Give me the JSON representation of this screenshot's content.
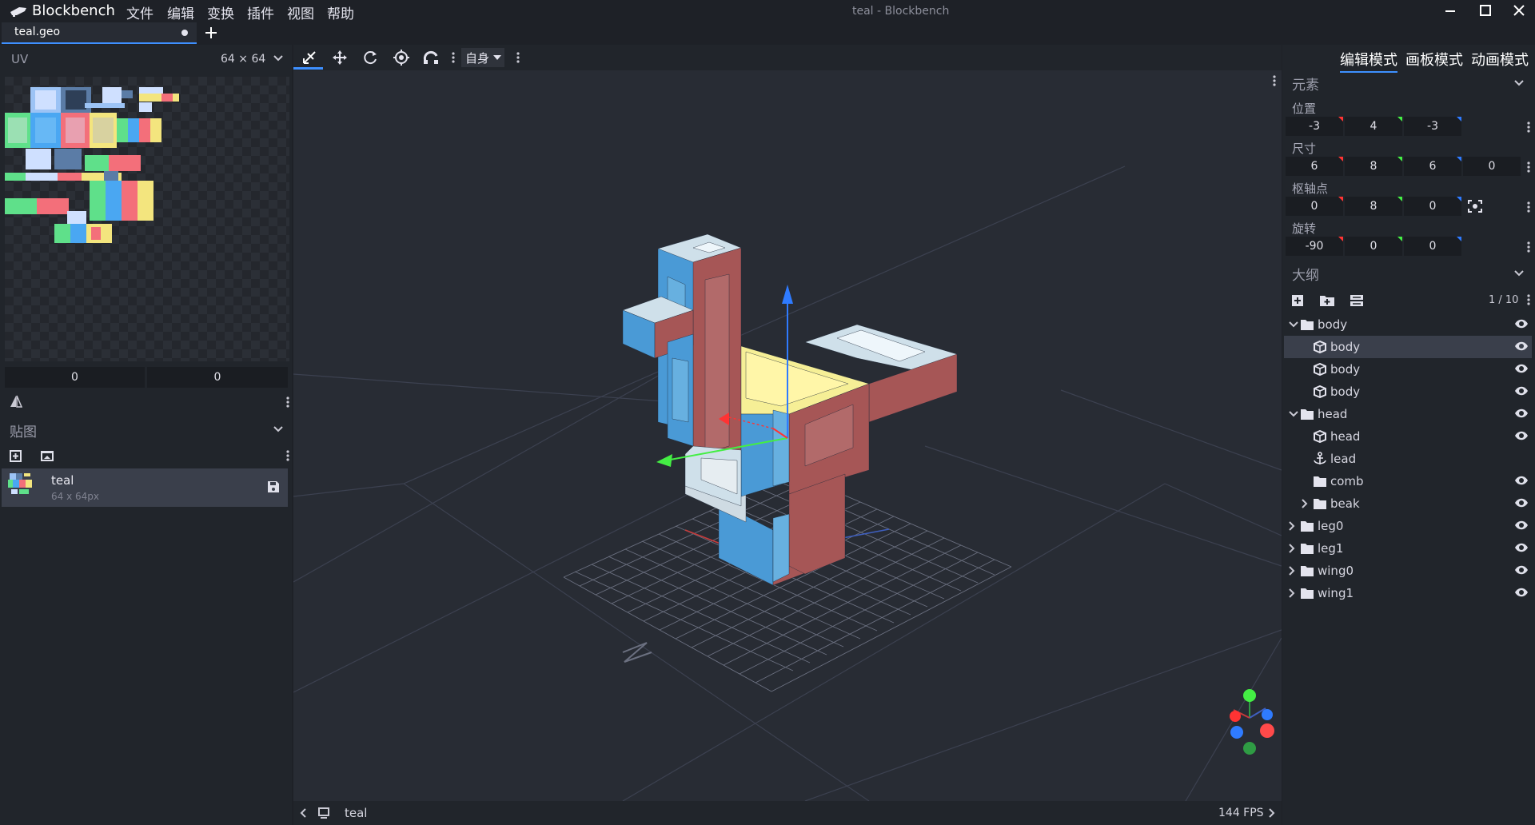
{
  "app": {
    "name": "Blockbench",
    "window_title": "teal - Blockbench",
    "menu": [
      "文件",
      "编辑",
      "变换",
      "插件",
      "视图",
      "帮助"
    ]
  },
  "tabs": [
    {
      "label": "teal.geo"
    }
  ],
  "uv_panel": {
    "title": "UV",
    "size_label": "64 × 64",
    "offset_x": "0",
    "offset_y": "0"
  },
  "textures_panel": {
    "title": "贴图",
    "items": [
      {
        "name": "teal",
        "size": "64 x 64px"
      }
    ]
  },
  "toolbar": {
    "space_select": "自身"
  },
  "modes": [
    "编辑模式",
    "画板模式",
    "动画模式"
  ],
  "element_panel": {
    "title": "元素",
    "position_label": "位置",
    "position": [
      "-3",
      "4",
      "-3"
    ],
    "size_label": "尺寸",
    "size": [
      "6",
      "8",
      "6",
      "0"
    ],
    "pivot_label": "枢轴点",
    "pivot": [
      "0",
      "8",
      "0"
    ],
    "rotation_label": "旋转",
    "rotation": [
      "-90",
      "0",
      "0"
    ]
  },
  "outliner": {
    "title": "大纲",
    "count": "1 / 10",
    "rows": [
      {
        "label": "body",
        "type": "group",
        "expanded": true,
        "indent": 0
      },
      {
        "label": "body",
        "type": "cube",
        "indent": 1,
        "selected": true
      },
      {
        "label": "body",
        "type": "cube",
        "indent": 1
      },
      {
        "label": "body",
        "type": "cube",
        "indent": 1
      },
      {
        "label": "head",
        "type": "group",
        "expanded": true,
        "indent": 0
      },
      {
        "label": "head",
        "type": "cube",
        "indent": 1
      },
      {
        "label": "lead",
        "type": "locator",
        "indent": 1
      },
      {
        "label": "comb",
        "type": "group",
        "indent": 1
      },
      {
        "label": "beak",
        "type": "group",
        "collapsed": true,
        "indent": 1
      },
      {
        "label": "leg0",
        "type": "group",
        "collapsed": true,
        "indent": 0
      },
      {
        "label": "leg1",
        "type": "group",
        "collapsed": true,
        "indent": 0
      },
      {
        "label": "wing0",
        "type": "group",
        "collapsed": true,
        "indent": 0
      },
      {
        "label": "wing1",
        "type": "group",
        "collapsed": true,
        "indent": 0
      }
    ]
  },
  "status": {
    "model_name": "teal",
    "fps": "144 FPS"
  },
  "colors": {
    "accent": "#3e90ff",
    "x_axis": "#ff3333",
    "y_axis": "#44ee44",
    "z_axis": "#2f7bff"
  }
}
